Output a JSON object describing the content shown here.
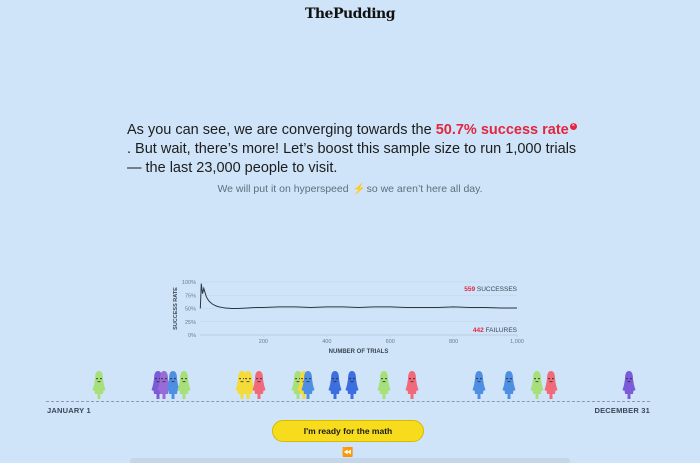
{
  "header": {
    "logo": "ThePudding"
  },
  "narrative": {
    "part1": "As you can see, we are converging towards the ",
    "highlight": "50.7% success rate",
    "part2": ". But wait, there’s more! Let’s boost this sample size to run 1,000 trials — the last 23,000 people to visit.",
    "info_icon": "x-circle-icon"
  },
  "subnote": {
    "before": "We will put it on hyperspeed ",
    "bolt_icon": "lightning-icon",
    "after": "so we aren’t here all day."
  },
  "chart_data": {
    "type": "line",
    "xlabel": "NUMBER OF TRIALS",
    "ylabel": "SUCCESS RATE",
    "xlim": [
      0,
      1000
    ],
    "ylim": [
      0,
      100
    ],
    "x_ticks": [
      200,
      400,
      600,
      800,
      1000
    ],
    "x_tick_labels": [
      "200",
      "400",
      "600",
      "800",
      "1,000"
    ],
    "y_ticks": [
      0,
      25,
      50,
      75,
      100
    ],
    "y_tick_labels": [
      "0%",
      "25%",
      "50%",
      "75%",
      "100%"
    ],
    "series": [
      {
        "x": [
          1,
          4,
          8,
          12,
          16,
          20,
          25,
          30,
          40,
          50,
          60,
          70,
          80,
          100,
          120,
          150,
          180,
          200,
          250,
          300,
          350,
          400,
          450,
          500,
          550,
          600,
          650,
          700,
          750,
          800,
          850,
          900,
          950,
          1000
        ],
        "values": [
          50,
          97,
          78,
          88,
          80,
          72,
          67,
          63,
          58,
          55,
          53,
          52,
          51,
          50,
          50,
          51,
          52,
          52,
          53,
          53,
          52,
          53,
          53,
          52,
          53,
          53,
          52,
          52,
          52,
          53,
          52,
          52,
          51,
          51
        ]
      }
    ],
    "annotations": {
      "successes_count": "559",
      "successes_label": "SUCCESSES",
      "failures_count": "442",
      "failures_label": "FAILURES"
    },
    "colors": {
      "line": "#2b3642",
      "highlight": "#e3263f",
      "axis": "#b7c7d8"
    }
  },
  "timeline": {
    "start_label": "JANUARY 1",
    "end_label": "DECEMBER 31"
  },
  "people": [
    {
      "color": "#a7e07a"
    },
    {
      "color": "#7b5bd8"
    },
    {
      "color": "#9a6ad6"
    },
    {
      "color": "#4f8fe3"
    },
    {
      "color": "#a7e07a"
    },
    {
      "color": "#f3dc3a"
    },
    {
      "color": "#f3dc3a"
    },
    {
      "color": "#f06a7a"
    },
    {
      "color": "#a7e07a"
    },
    {
      "color": "#f3dc3a"
    },
    {
      "color": "#4f8fe3"
    },
    {
      "color": "#3d6ee0"
    },
    {
      "color": "#3d6ee0"
    },
    {
      "color": "#a7e07a"
    },
    {
      "color": "#f06a7a"
    },
    {
      "color": "#4f8fe3"
    },
    {
      "color": "#4f8fe3"
    },
    {
      "color": "#a7e07a"
    },
    {
      "color": "#f06a7a"
    },
    {
      "color": "#7b5bd8"
    }
  ],
  "buttons": {
    "cta_label": "I'm ready for the math",
    "rewind_icon": "rewind-icon",
    "rewind_glyph": "⏪"
  },
  "colors": {
    "background": "#cfe4f8",
    "accent": "#e3263f",
    "cta": "#f6dc1c"
  }
}
